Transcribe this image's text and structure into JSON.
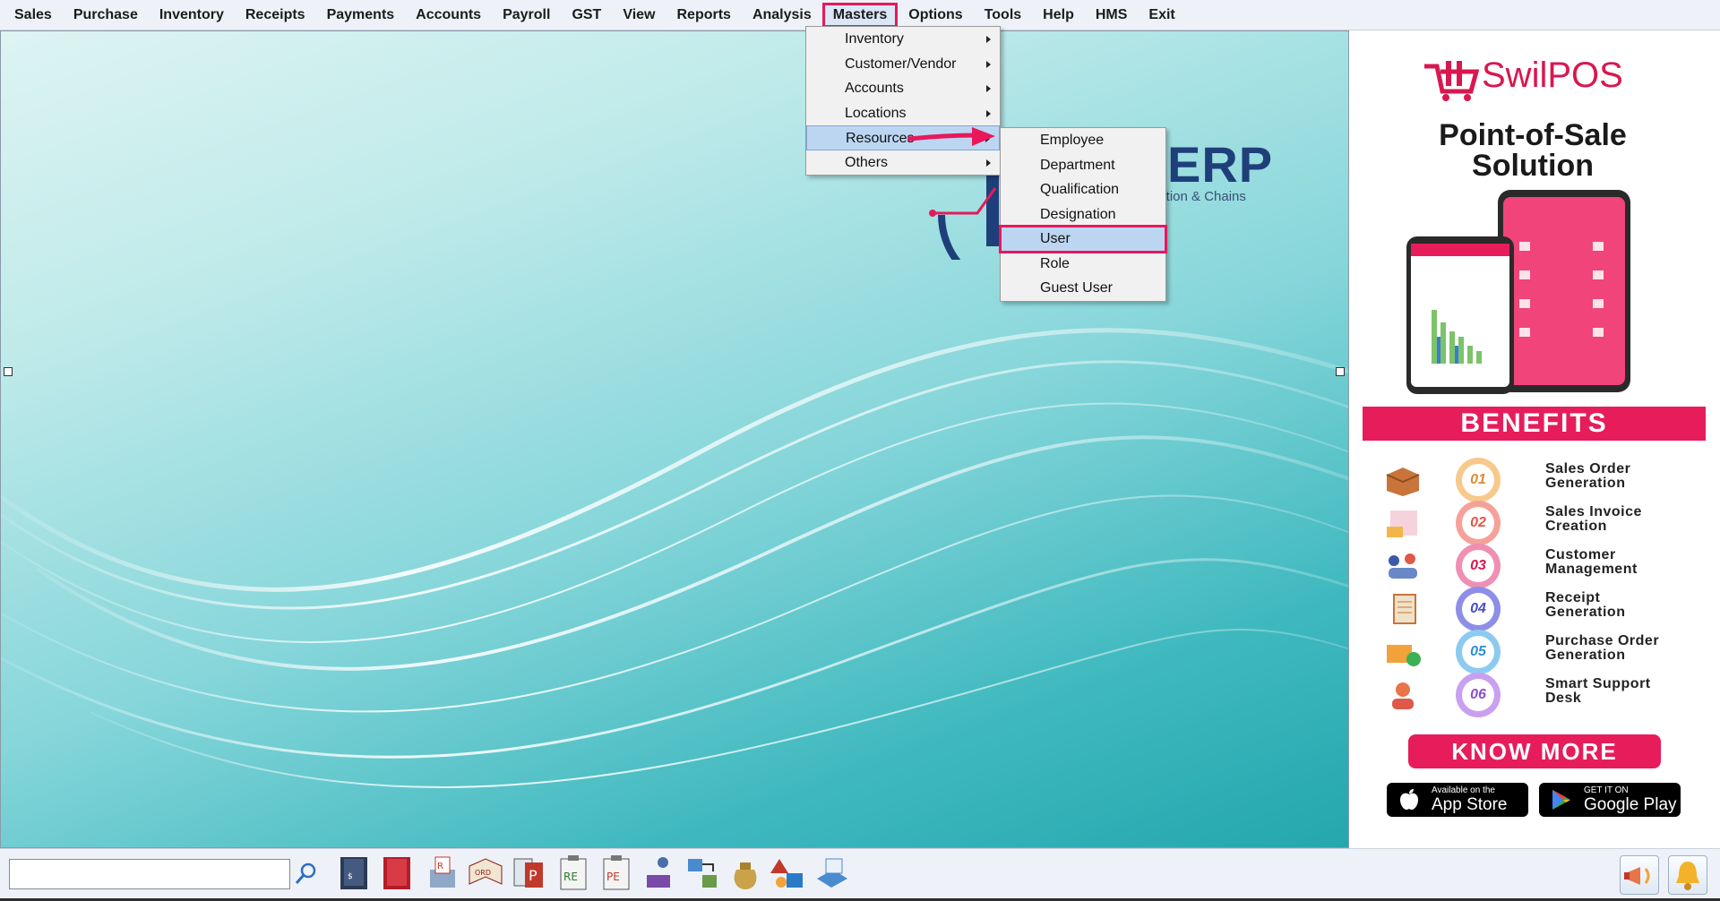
{
  "menubar": {
    "items": [
      {
        "label": "Sales"
      },
      {
        "label": "Purchase"
      },
      {
        "label": "Inventory"
      },
      {
        "label": "Receipts"
      },
      {
        "label": "Payments"
      },
      {
        "label": "Accounts"
      },
      {
        "label": "Payroll"
      },
      {
        "label": "GST"
      },
      {
        "label": "View"
      },
      {
        "label": "Reports"
      },
      {
        "label": "Analysis"
      },
      {
        "label": "Masters"
      },
      {
        "label": "Options"
      },
      {
        "label": "Tools"
      },
      {
        "label": "Help"
      },
      {
        "label": "HMS"
      },
      {
        "label": "Exit"
      }
    ],
    "active": "Masters"
  },
  "masters_menu": {
    "items": [
      {
        "label": "Inventory"
      },
      {
        "label": "Customer/Vendor"
      },
      {
        "label": "Accounts"
      },
      {
        "label": "Locations"
      },
      {
        "label": "Resources"
      },
      {
        "label": "Others"
      }
    ],
    "highlighted": "Resources"
  },
  "resources_menu": {
    "items": [
      {
        "label": "Employee"
      },
      {
        "label": "Department"
      },
      {
        "label": "Qualification"
      },
      {
        "label": "Designation"
      },
      {
        "label": "User"
      },
      {
        "label": "Role"
      },
      {
        "label": "Guest User"
      }
    ],
    "selected": "User"
  },
  "logo": {
    "text": "ERP",
    "tagline": "bution & Chains"
  },
  "ad": {
    "brand": "SwilPOS",
    "title_line1": "Point-of-Sale",
    "title_line2": "Solution",
    "benefits_heading": "BENEFITS",
    "benefits": [
      {
        "num": "01",
        "line1": "Sales Order",
        "line2": "Generation",
        "color": "#f7c98a"
      },
      {
        "num": "02",
        "line1": "Sales Invoice",
        "line2": "Creation",
        "color": "#f5a19a"
      },
      {
        "num": "03",
        "line1": "Customer",
        "line2": "Management",
        "color": "#ef8fb3"
      },
      {
        "num": "04",
        "line1": "Receipt",
        "line2": "Generation",
        "color": "#8d8ee8"
      },
      {
        "num": "05",
        "line1": "Purchase Order",
        "line2": "Generation",
        "color": "#8ccbf0"
      },
      {
        "num": "06",
        "line1": "Smart Support",
        "line2": "Desk",
        "color": "#c9a0ef"
      }
    ],
    "cta": "KNOW MORE",
    "appstore_small": "Available on the",
    "appstore_big": "App Store",
    "googleplay_small": "GET IT ON",
    "googleplay_big": "Google Play"
  },
  "toolbar": {
    "search_value": "",
    "search_placeholder": ""
  },
  "colors": {
    "accent": "#e8185a",
    "menu_highlight": "#bcd6f2",
    "ad_pink": "#e71d5b",
    "logo_blue": "#1f3f7a"
  }
}
